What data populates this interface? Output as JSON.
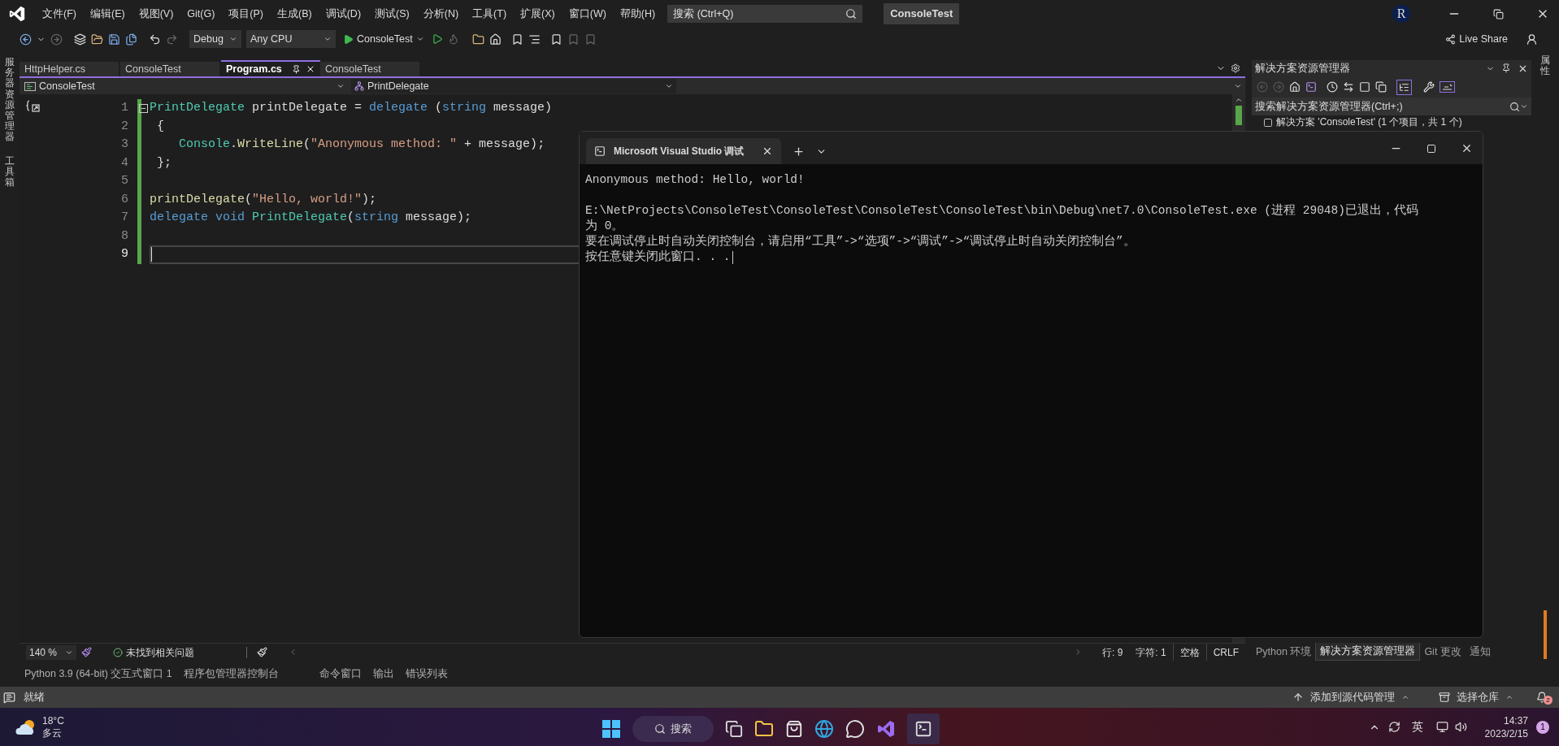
{
  "menu": [
    "文件(F)",
    "编辑(E)",
    "视图(V)",
    "Git(G)",
    "项目(P)",
    "生成(B)",
    "调试(D)",
    "测试(S)",
    "分析(N)",
    "工具(T)",
    "扩展(X)",
    "窗口(W)",
    "帮助(H)"
  ],
  "search": {
    "placeholder": "搜索 (Ctrl+Q)"
  },
  "solution_name": "ConsoleTest",
  "account_initial": "R",
  "live_share": "Live Share",
  "toolbar": {
    "configuration": "Debug",
    "platform": "Any CPU",
    "run_target": "ConsoleTest"
  },
  "left_strip": [
    "服务器资源管理器",
    "工具箱"
  ],
  "right_strip": [
    "属性"
  ],
  "doc_tabs": [
    {
      "label": "HttpHelper.cs",
      "selected": false
    },
    {
      "label": "ConsoleTest",
      "selected": false
    },
    {
      "label": "Program.cs",
      "selected": true
    },
    {
      "label": "ConsoleTest",
      "selected": false
    }
  ],
  "nav_bar": {
    "project": "ConsoleTest",
    "member": "PrintDelegate"
  },
  "code_lines": [
    {
      "number": "1",
      "current": false,
      "tokens": [
        {
          "kind": "type",
          "text": "PrintDelegate"
        },
        {
          "kind": "plain",
          "text": " printDelegate = "
        },
        {
          "kind": "keyword",
          "text": "delegate"
        },
        {
          "kind": "plain",
          "text": " ("
        },
        {
          "kind": "keyword",
          "text": "string"
        },
        {
          "kind": "plain",
          "text": " message)"
        }
      ]
    },
    {
      "number": "2",
      "current": false,
      "tokens": [
        {
          "kind": "plain",
          "text": " {"
        }
      ]
    },
    {
      "number": "3",
      "current": false,
      "tokens": [
        {
          "kind": "type",
          "text": "    Console"
        },
        {
          "kind": "plain",
          "text": "."
        },
        {
          "kind": "method",
          "text": "WriteLine"
        },
        {
          "kind": "plain",
          "text": "("
        },
        {
          "kind": "string",
          "text": "\"Anonymous method: \""
        },
        {
          "kind": "plain",
          "text": " + message);"
        }
      ]
    },
    {
      "number": "4",
      "current": false,
      "tokens": [
        {
          "kind": "plain",
          "text": " };"
        }
      ]
    },
    {
      "number": "5",
      "current": false
    },
    {
      "number": "6",
      "current": false,
      "tokens": [
        {
          "kind": "method",
          "text": "printDelegate"
        },
        {
          "kind": "plain",
          "text": "("
        },
        {
          "kind": "string",
          "text": "\"Hello, world!\""
        },
        {
          "kind": "plain",
          "text": ");"
        }
      ]
    },
    {
      "number": "7",
      "current": false,
      "tokens": [
        {
          "kind": "keyword",
          "text": "delegate void"
        },
        {
          "kind": "type",
          "text": " PrintDelegate"
        },
        {
          "kind": "plain",
          "text": "("
        },
        {
          "kind": "keyword",
          "text": "string"
        },
        {
          "kind": "plain",
          "text": " message);"
        }
      ]
    },
    {
      "number": "8",
      "current": false
    },
    {
      "number": "9",
      "current": true
    }
  ],
  "editor_status": {
    "zoom": "140 %",
    "issues": "未找到相关问题",
    "line": "行: 9",
    "column": "字符: 1",
    "indent": "空格",
    "line_ending": "CRLF"
  },
  "solution_explorer": {
    "title": "解决方案资源管理器",
    "search_placeholder": "搜索解决方案资源管理器(Ctrl+;)",
    "tree_root": "解决方案 'ConsoleTest' (1 个项目，共 1 个)"
  },
  "panel_tabs": [
    {
      "label": "Python 环境",
      "selected": false
    },
    {
      "label": "解决方案资源管理器",
      "selected": true
    },
    {
      "label": "Git 更改",
      "selected": false
    },
    {
      "label": "通知",
      "selected": false
    }
  ],
  "tool_tabs": [
    "Python 3.9 (64-bit) 交互式窗口 1",
    "程序包管理器控制台",
    "命令窗口",
    "输出",
    "错误列表"
  ],
  "status_bar": {
    "state": "就绪",
    "source_control": "添加到源代码管理",
    "repository": "选择仓库",
    "notifications": "2"
  },
  "console": {
    "title": "Microsoft Visual Studio 调试",
    "blocks": [
      [
        "Anonymous method: Hello, world!"
      ],
      [
        "E:\\NetProjects\\ConsoleTest\\ConsoleTest\\ConsoleTest\\ConsoleTest\\bin\\Debug\\net7.0\\ConsoleTest.exe (进程 29048)已退出，代码",
        "为 0。",
        "要在调试停止时自动关闭控制台，请启用“工具”->“选项”->“调试”->“调试停止时自动关闭控制台”。",
        "按任意键关闭此窗口. . ."
      ]
    ]
  },
  "taskbar": {
    "temperature": "18°C",
    "weather": "多云",
    "search": "搜索",
    "time": "14:37",
    "date": "2023/2/15",
    "ime": "英",
    "notifications": "1"
  }
}
